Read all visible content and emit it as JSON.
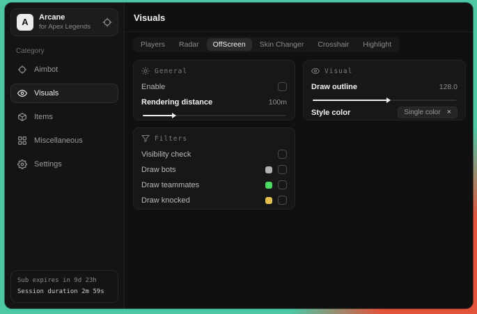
{
  "backdrop": {
    "teal_color": "#4ec7a5",
    "red_color": "#e2533c"
  },
  "sidebar": {
    "logo_letter": "A",
    "app_name": "Arcane",
    "app_subtitle": "for Apex Legends",
    "category_label": "Category",
    "items": [
      {
        "label": "Aimbot",
        "icon": "crosshair-icon",
        "active": false
      },
      {
        "label": "Visuals",
        "icon": "eye-icon",
        "active": true
      },
      {
        "label": "Items",
        "icon": "package-icon",
        "active": false
      },
      {
        "label": "Miscellaneous",
        "icon": "grid-icon",
        "active": false
      },
      {
        "label": "Settings",
        "icon": "gear-icon",
        "active": false
      }
    ],
    "footer": {
      "sub_expires": "Sub expires in 9d 23h",
      "session_duration": "Session duration 2m 59s"
    }
  },
  "main": {
    "title": "Visuals",
    "tabs": [
      {
        "label": "Players",
        "active": false
      },
      {
        "label": "Radar",
        "active": false
      },
      {
        "label": "OffScreen",
        "active": true
      },
      {
        "label": "Skin Changer",
        "active": false
      },
      {
        "label": "Crosshair",
        "active": false
      },
      {
        "label": "Highlight",
        "active": false
      }
    ],
    "panels": {
      "general": {
        "title": "General",
        "enable_label": "Enable",
        "enable_checked": false,
        "rendering_distance_label": "Rendering distance",
        "rendering_distance_value": "100m",
        "rendering_distance_fill_percent": 21
      },
      "visual": {
        "title": "Visual",
        "draw_outline_label": "Draw outline",
        "draw_outline_value": "128.0",
        "draw_outline_fill_percent": 52,
        "style_color_label": "Style color",
        "style_color_value": "Single color",
        "style_color_close": "×"
      },
      "filters": {
        "title": "Filters",
        "rows": [
          {
            "label": "Visibility check",
            "swatch": null,
            "checked": false
          },
          {
            "label": "Draw bots",
            "swatch": "#b3b3b3",
            "checked": false
          },
          {
            "label": "Draw teammates",
            "swatch": "#4cd964",
            "checked": false
          },
          {
            "label": "Draw knocked",
            "swatch": "#e3c14e",
            "checked": false
          }
        ]
      }
    }
  }
}
